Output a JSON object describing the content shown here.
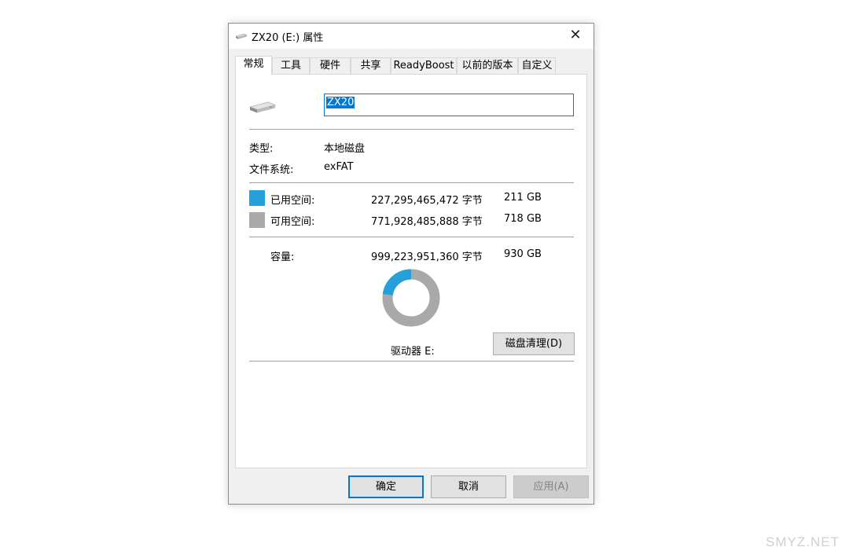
{
  "window": {
    "title": "ZX20 (E:) 属性",
    "close_glyph": "✕"
  },
  "tabs": [
    {
      "label": "常规",
      "active": true
    },
    {
      "label": "工具"
    },
    {
      "label": "硬件"
    },
    {
      "label": "共享"
    },
    {
      "label": "ReadyBoost"
    },
    {
      "label": "以前的版本"
    },
    {
      "label": "自定义"
    }
  ],
  "general": {
    "drive_name_value": "ZX20",
    "type_label": "类型:",
    "type_value": "本地磁盘",
    "fs_label": "文件系统:",
    "fs_value": "exFAT",
    "used": {
      "label": "已用空间:",
      "bytes": "227,295,465,472 字节",
      "size": "211 GB",
      "color": "#26a0da"
    },
    "free": {
      "label": "可用空间:",
      "bytes": "771,928,485,888 字节",
      "size": "718 GB",
      "color": "#a9a9a9"
    },
    "capacity": {
      "label": "容量:",
      "bytes": "999,223,951,360 字节",
      "size": "930 GB"
    },
    "used_fraction": 0.2275,
    "drive_label": "驱动器 E:",
    "cleanup_button": "磁盘清理(D)"
  },
  "buttons": {
    "ok": "确定",
    "cancel": "取消",
    "apply": "应用(A)"
  },
  "watermark": "SMYZ.NET",
  "icons": {
    "title": "drive-icon",
    "drive": "drive-icon"
  }
}
